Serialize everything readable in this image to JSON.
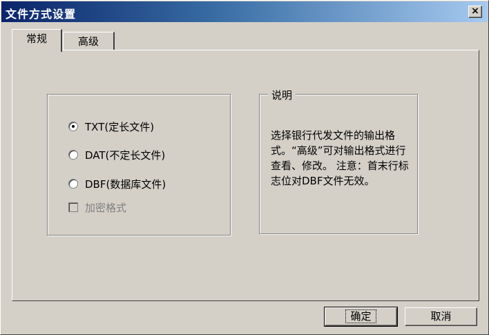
{
  "window": {
    "title": "文件方式设置",
    "close_glyph": "×"
  },
  "tabs": [
    {
      "label": "常规",
      "active": true
    },
    {
      "label": "高级",
      "active": false
    }
  ],
  "format_group": {
    "options": [
      {
        "label": "TXT(定长文件)",
        "checked": true
      },
      {
        "label": "DAT(不定长文件)",
        "checked": false
      },
      {
        "label": "DBF(数据库文件)",
        "checked": false
      }
    ],
    "encrypt_label": "加密格式"
  },
  "description": {
    "title": "说明",
    "text": "选择银行代发文件的输出格式。“高级”可对输出格式进行查看、修改。 注意：首末行标志位对DBF文件无效。"
  },
  "buttons": {
    "ok": "确定",
    "cancel": "取消"
  }
}
